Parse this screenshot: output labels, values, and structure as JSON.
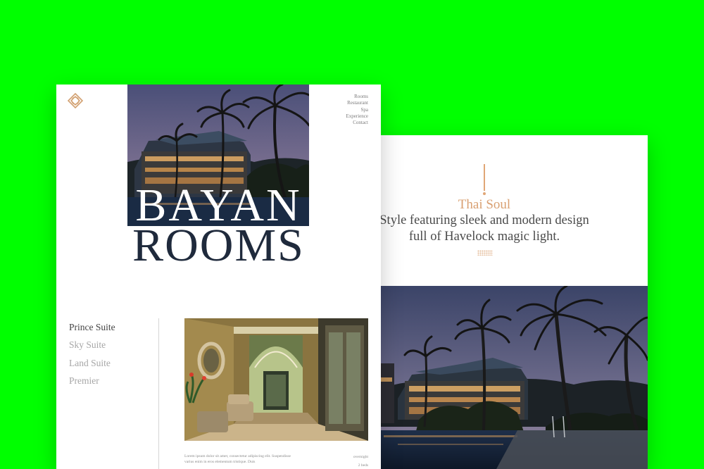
{
  "colors": {
    "background": "#00ff00",
    "accent": "#d9a072",
    "title_dark": "#1f2a3c",
    "text_gray": "#4a4a4a"
  },
  "left_page": {
    "logo_icon": "diamond-knot-logo",
    "nav": [
      "Rooms",
      "Restaurant",
      "Spa",
      "Experience",
      "Contact"
    ],
    "hero_title": {
      "line1": "BAYAN",
      "line2": "ROOMS"
    },
    "suites": [
      {
        "label": "Prince Suite",
        "active": true
      },
      {
        "label": "Sky Suite",
        "active": false
      },
      {
        "label": "Land Suite",
        "active": false
      },
      {
        "label": "Premier",
        "active": false
      }
    ],
    "body_text": "Lorem ipsum dolor sit amet, consectetur adipiscing elit. Suspendisse varius enim in eros elementum tristique. Duis",
    "meta": [
      "overnight",
      "2 beds"
    ]
  },
  "right_page": {
    "title": "Thai Soul",
    "description": "Style featuring sleek and modern design full of Havelock magic light."
  }
}
